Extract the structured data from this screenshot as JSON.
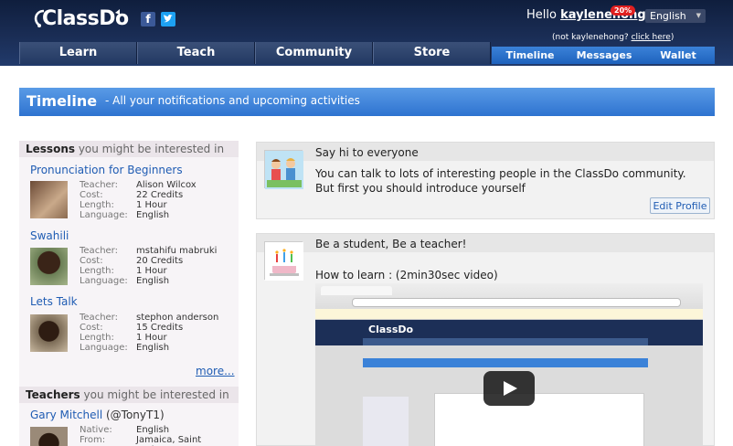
{
  "header": {
    "logo_text": "ClassDo",
    "hello_prefix": "Hello ",
    "username": "kaylenehong",
    "badge": "20%",
    "language": "English",
    "not_user_prefix": "(not kaylenehong? ",
    "click_here": "click here",
    "not_user_suffix": ")"
  },
  "nav": {
    "main": [
      "Learn",
      "Teach",
      "Community",
      "Store"
    ],
    "sub": [
      "Timeline",
      "Messages",
      "Wallet"
    ]
  },
  "banner": {
    "title": "Timeline",
    "subtitle": "- All your notifications and upcoming activities"
  },
  "sidebar": {
    "lessons_heading_bold": "Lessons",
    "lessons_heading_rest": " you might be interested in",
    "lessons": [
      {
        "title": "Pronunciation for Beginners",
        "teacher": "Alison Wilcox",
        "cost": "22 Credits",
        "length": "1 Hour",
        "language": "English"
      },
      {
        "title": "Swahili",
        "teacher": "mstahifu mabruki",
        "cost": "20 Credits",
        "length": "1 Hour",
        "language": "English"
      },
      {
        "title": "Lets Talk",
        "teacher": "stephon anderson",
        "cost": "15 Credits",
        "length": "1 Hour",
        "language": "English"
      }
    ],
    "field_labels": {
      "teacher": "Teacher:",
      "cost": "Cost:",
      "length": "Length:",
      "language": "Language:",
      "native": "Native:",
      "from": "From:"
    },
    "more": "more...",
    "teachers_heading_bold": "Teachers",
    "teachers_heading_rest": " you might be interested in",
    "teacher": {
      "name": "Gary Mitchell",
      "handle": "(@TonyT1)",
      "native": "English",
      "from": "Jamaica, Saint Andrew"
    }
  },
  "feed": {
    "card1": {
      "title": "Say hi to everyone",
      "line1": "You can talk to lots of interesting people in the ClassDo community.",
      "line2": "But first you should introduce yourself",
      "button": "Edit Profile"
    },
    "card2": {
      "title": "Be a student, Be a teacher!",
      "video_label": "How to learn : (2min30sec video)",
      "video_logo": "ClassDo"
    }
  },
  "colors": {
    "header": "#1a2d55",
    "accent": "#2e73d0",
    "link": "#1f5cb3"
  }
}
